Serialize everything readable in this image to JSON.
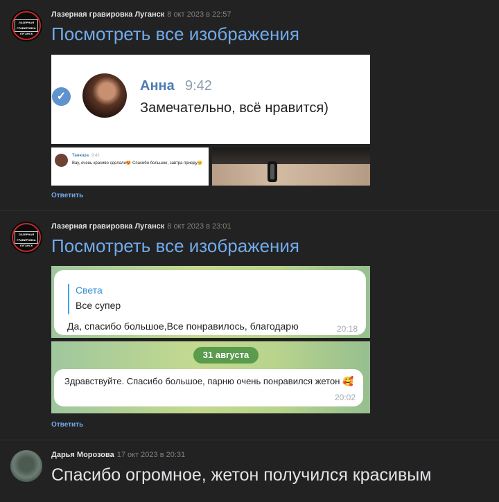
{
  "posts": [
    {
      "author": "Лазерная гравировка Луганск",
      "date": "8 окт 2023 в 22:57",
      "view_all": "Посмотреть все изображения",
      "image_main": {
        "name": "Анна",
        "time": "9:42",
        "text": "Замечательно, всё нравится)"
      },
      "thumb": {
        "name": "Танюша",
        "time": "9:42",
        "text": "Вау, очень красиво сделали😍 Спасибо большое, завтра приеду😊"
      },
      "reply": "Ответить"
    },
    {
      "author": "Лазерная гравировка Луганск",
      "date": "8 окт 2023 в 23:01",
      "view_all": "Посмотреть все изображения",
      "chat1": {
        "quote_name": "Света",
        "quote_text": "Все супер",
        "text": "Да, спасибо большое,Все понравилось, благодарю",
        "time": "20:18"
      },
      "chat2": {
        "date_pill": "31 августа",
        "text": "Здравствуйте.  Спасибо большое,  парню очень понравился жетон 🥰",
        "time": "20:02"
      },
      "reply": "Ответить"
    },
    {
      "author": "Дарья Морозова",
      "date": "17 окт 2023 в 20:31",
      "text": "Спасибо огромное, жетон получился красивым"
    }
  ],
  "logo_text": "ЛАЗЕРНАЯ ГРАВИРОВКА ЛУГАНСК",
  "colors": {
    "background": "#222222",
    "link": "#71aaeb",
    "text": "#e1e3e6",
    "date": "#828282"
  }
}
